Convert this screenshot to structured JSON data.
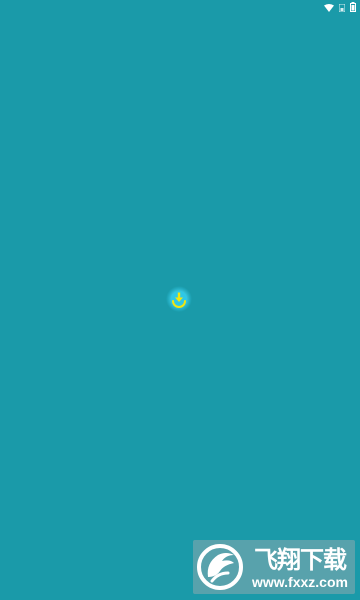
{
  "status_bar": {
    "icons": [
      "wifi-icon",
      "signal-icon",
      "battery-icon"
    ]
  },
  "splash": {
    "logo_icon": "download-icon",
    "background_color": "#1a9aa9",
    "logo_color": "#f2e60f",
    "logo_glow_color": "#2fd8ff"
  },
  "watermark": {
    "title": "飞翔下载",
    "url": "www.fxxz.com"
  }
}
